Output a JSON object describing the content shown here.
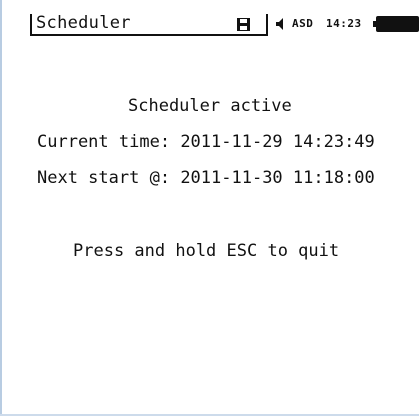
{
  "app": {
    "title": "Scheduler"
  },
  "status_bar": {
    "save_icon": "floppy-disk-icon",
    "speaker_icon": "speaker-icon",
    "mode_label": "ASD",
    "clock": "14:23",
    "battery_icon": "battery-icon"
  },
  "main": {
    "heading": "Scheduler active",
    "current_time_label": "Current time:",
    "current_time_value": "2011-11-29 14:23:49",
    "next_start_label": "Next start @:",
    "next_start_value": "2011-11-30 11:18:00",
    "hint": "Press and hold ESC to quit"
  },
  "colors": {
    "background": "#ffffff",
    "text": "#111111",
    "frame": "#b8cce2"
  }
}
